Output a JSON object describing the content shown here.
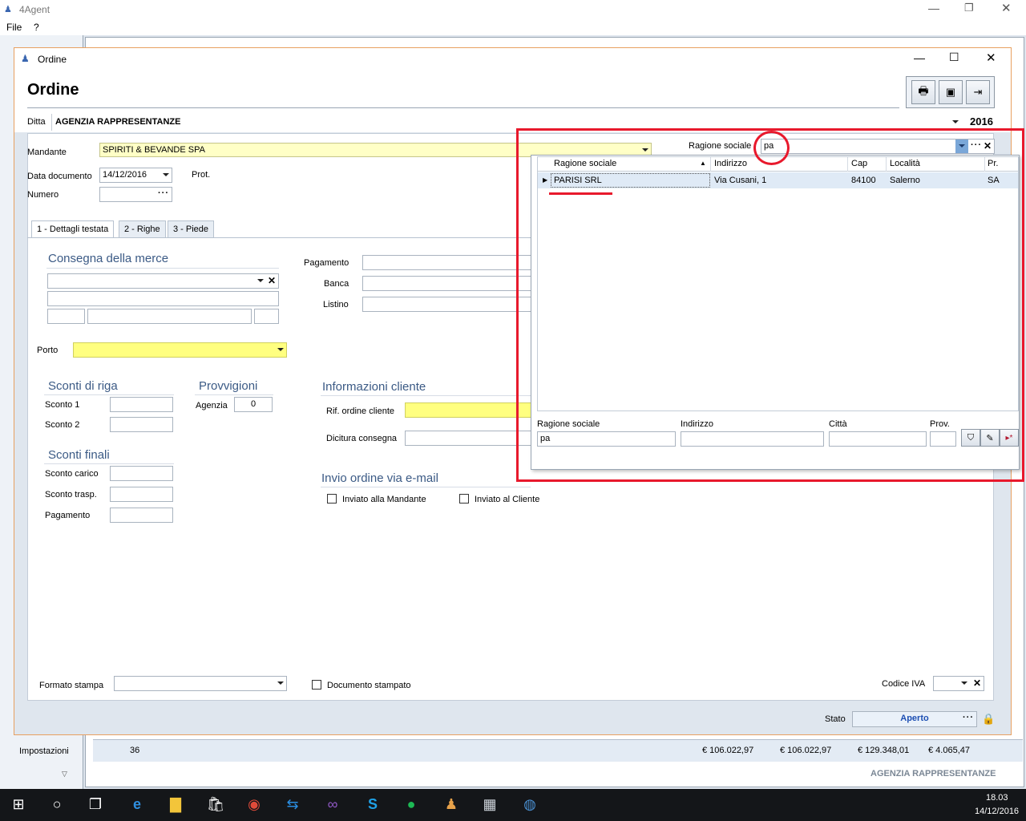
{
  "app": {
    "title": "4Agent",
    "menu": [
      "File",
      "?"
    ],
    "company_footer": "AGENZIA RAPPRESENTANZE",
    "sidebar_item": "Impostazioni",
    "back_row": {
      "count": "36",
      "v1": "€ 106.022,97",
      "v2": "€ 106.022,97",
      "v3": "€ 129.348,01",
      "v4": "€ 4.065,47"
    }
  },
  "dialog": {
    "window_title": "Ordine",
    "heading": "Ordine",
    "ditta_label": "Ditta",
    "ditta_value": "AGENZIA RAPPRESENTANZE",
    "year": "2016",
    "mandante_label": "Mandante",
    "mandante_value": "SPIRITI & BEVANDE SPA",
    "data_doc_label": "Data documento",
    "data_doc_value": "14/12/2016",
    "prot_label": "Prot.",
    "numero_label": "Numero",
    "ragione_label": "Ragione sociale",
    "ragione_value": "pa",
    "tabs": [
      "1 - Dettagli testata",
      "2 - Righe",
      "3 - Piede"
    ],
    "consegna_title": "Consegna della merce",
    "porto_label": "Porto",
    "pagamento_label": "Pagamento",
    "banca_label": "Banca",
    "listino_label": "Listino",
    "sconti_riga_title": "Sconti di riga",
    "sconto1_label": "Sconto 1",
    "sconto2_label": "Sconto 2",
    "provvigioni_title": "Provvigioni",
    "agenzia_label": "Agenzia",
    "agenzia_value": "0",
    "info_cliente_title": "Informazioni cliente",
    "rif_ordine_label": "Rif. ordine cliente",
    "dicitura_label": "Dicitura consegna",
    "sconti_finali_title": "Sconti finali",
    "sconto_carico_label": "Sconto carico",
    "sconto_trasp_label": "Sconto trasp.",
    "pagamento2_label": "Pagamento",
    "invio_title": "Invio ordine via e-mail",
    "inviato_mandante": "Inviato alla Mandante",
    "inviato_cliente": "Inviato al Cliente",
    "formato_stampa_label": "Formato stampa",
    "doc_stampato_label": "Documento stampato",
    "codice_iva_label": "Codice IVA",
    "stato_label": "Stato",
    "stato_value": "Aperto"
  },
  "lookup": {
    "columns": [
      "Ragione sociale",
      "Indirizzo",
      "Cap",
      "Località",
      "Pr."
    ],
    "rows": [
      {
        "ragione": "PARISI SRL",
        "indirizzo": "Via Cusani, 1",
        "cap": "84100",
        "localita": "Salerno",
        "pr": "SA"
      }
    ],
    "filter_labels": [
      "Ragione sociale",
      "Indirizzo",
      "Città",
      "Prov."
    ],
    "filter_ragione_value": "pa"
  },
  "taskbar": {
    "time": "18.03",
    "date": "14/12/2016"
  },
  "colors": {
    "annotation_red": "#e8192c",
    "section_blue": "#3b5a85",
    "window_border": "#e8a060"
  }
}
